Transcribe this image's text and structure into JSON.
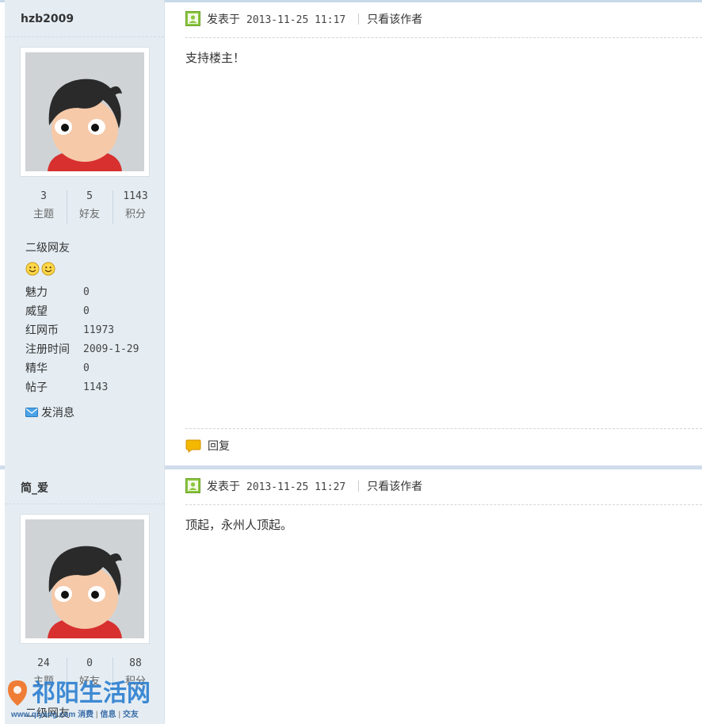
{
  "posts": [
    {
      "author": "hzb2009",
      "stats": [
        {
          "value": "3",
          "label": "主题"
        },
        {
          "value": "5",
          "label": "好友"
        },
        {
          "value": "1143",
          "label": "积分"
        }
      ],
      "rank": "二级网友",
      "info": [
        {
          "key": "魅力",
          "value": "0"
        },
        {
          "key": "威望",
          "value": "0"
        },
        {
          "key": "红网币",
          "value": "11973"
        },
        {
          "key": "注册时间",
          "value": "2009-1-29"
        },
        {
          "key": "精华",
          "value": "0"
        },
        {
          "key": "帖子",
          "value": "1143"
        }
      ],
      "message_label": "发消息",
      "posted_label": "发表于",
      "posted_time": "2013-11-25 11:17",
      "only_author_label": "只看该作者",
      "content": "支持楼主！",
      "reply_label": "回复"
    },
    {
      "author": "简_爱",
      "stats": [
        {
          "value": "24",
          "label": "主题"
        },
        {
          "value": "0",
          "label": "好友"
        },
        {
          "value": "88",
          "label": "积分"
        }
      ],
      "rank": "二级网友",
      "posted_label": "发表于",
      "posted_time": "2013-11-25 11:27",
      "only_author_label": "只看该作者",
      "content": "顶起，永州人顶起。"
    }
  ],
  "watermark": {
    "brand": "祁阳生活网",
    "url": "www.qiyang.com",
    "tags": [
      "消费",
      "信息",
      "交友"
    ]
  },
  "colors": {
    "sidebar_bg": "#e5edf3",
    "accent_green": "#8cc63f",
    "brand_blue": "#2b7fd0",
    "brand_orange": "#f07020"
  },
  "icons": {
    "post": "user-post-icon",
    "reply": "speech-bubble-icon",
    "message": "envelope-icon",
    "rank": "smiley-icon"
  }
}
